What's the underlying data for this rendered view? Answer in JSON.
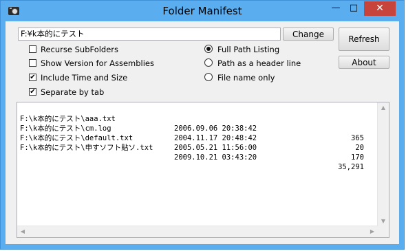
{
  "window": {
    "title": "Folder Manifest",
    "controls": {
      "minimize": "—",
      "maximize": "□",
      "close": "✕"
    }
  },
  "path_input": {
    "value": "F:¥k本的にテスト"
  },
  "buttons": {
    "change": "Change",
    "refresh": "Refresh",
    "about": "About"
  },
  "options": [
    {
      "label": "Recurse SubFolders",
      "checked": false
    },
    {
      "label": "Show Version for Assemblies",
      "checked": false
    },
    {
      "label": "Include Time and Size",
      "checked": true
    },
    {
      "label": "Separate by tab",
      "checked": true
    }
  ],
  "listing_mode": [
    {
      "label": "Full Path Listing",
      "selected": true
    },
    {
      "label": "Path as a header line",
      "selected": false
    },
    {
      "label": "File name only",
      "selected": false
    }
  ],
  "files": [
    {
      "path": "F:\\k本的にテスト\\aaa.txt",
      "datetime": "2006.09.06 20:38:42",
      "size": "365"
    },
    {
      "path": "F:\\k本的にテスト\\cm.log",
      "datetime": "2004.11.17 20:48:42",
      "size": "20"
    },
    {
      "path": "F:\\k本的にテスト\\default.txt",
      "datetime": "2005.05.21 11:56:00",
      "size": "170"
    },
    {
      "path": "F:\\k本的にテスト\\申すソフト貼ソ.txt",
      "datetime": "2009.10.21 03:43:20",
      "size": "35,291"
    }
  ],
  "icons": {
    "app": "camera-icon",
    "checkbox_mark": "✔",
    "scroll_up": "▲",
    "scroll_down": "▼",
    "scroll_left": "◀",
    "scroll_right": "▶"
  },
  "colors": {
    "titlebar": "#5aaef0",
    "close_button": "#c7443c",
    "client": "#f0f0f0"
  }
}
